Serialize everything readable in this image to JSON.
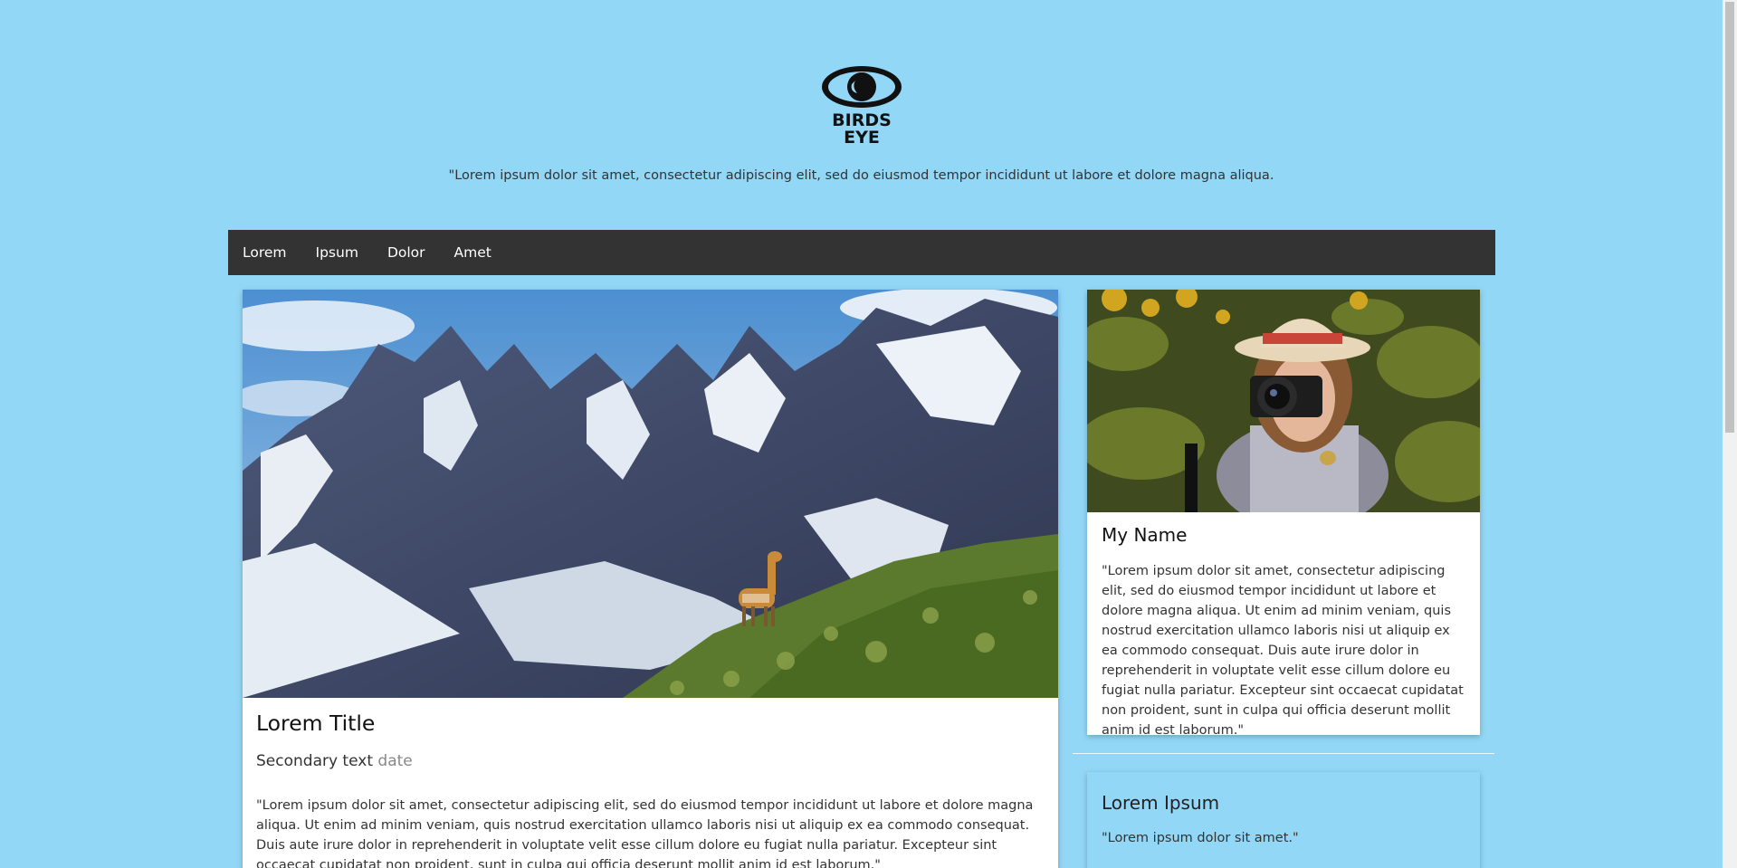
{
  "header": {
    "logo_text_line1": "BIRDS",
    "logo_text_line2": "EYE",
    "tagline": "\"Lorem ipsum dolor sit amet, consectetur adipiscing elit, sed do eiusmod tempor incididunt ut labore et dolore magna aliqua."
  },
  "nav": {
    "items": [
      "Lorem",
      "Ipsum",
      "Dolor",
      "Amet"
    ]
  },
  "main": {
    "title": "Lorem Title",
    "secondary": "Secondary text",
    "date": "date",
    "body": "\"Lorem ipsum dolor sit amet, consectetur adipiscing elit, sed do eiusmod tempor incididunt ut labore et dolore magna aliqua. Ut enim ad minim veniam, quis nostrud exercitation ullamco laboris nisi ut aliquip ex ea commodo consequat. Duis aute irure dolor in reprehenderit in voluptate velit esse cillum dolore eu fugiat nulla pariatur. Excepteur sint occaecat cupidatat non proident, sunt in culpa qui officia deserunt mollit anim id est laborum.\""
  },
  "sidebar": {
    "profile_name": "My Name",
    "profile_text": "\"Lorem ipsum dolor sit amet, consectetur adipiscing elit, sed do eiusmod tempor incididunt ut labore et dolore magna aliqua. Ut enim ad minim veniam, quis nostrud exercitation ullamco laboris nisi ut aliquip ex ea commodo consequat. Duis aute irure dolor in reprehenderit in voluptate velit esse cillum dolore eu fugiat nulla pariatur. Excepteur sint occaecat cupidatat non proident, sunt in culpa qui officia deserunt mollit anim id est laborum.\"",
    "card_title": "Lorem Ipsum",
    "card_text": "\"Lorem ipsum dolor sit amet.\""
  },
  "colors": {
    "background": "#93d7f7",
    "nav_background": "#333333",
    "card_background": "#ffffff"
  }
}
